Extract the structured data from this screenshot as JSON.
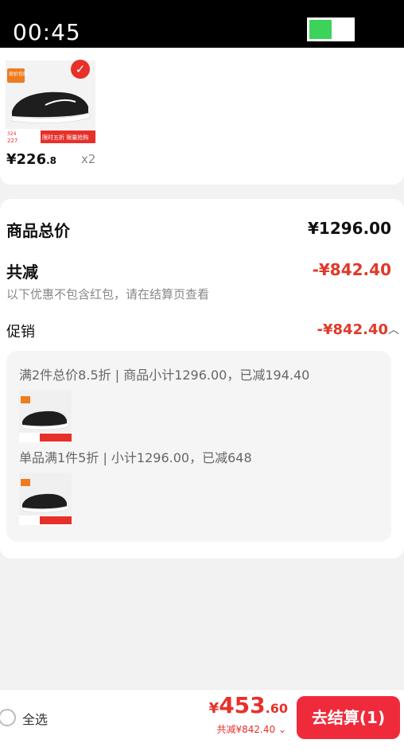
{
  "status": {
    "time": "00:45",
    "battery_fraction": 0.5,
    "battery_color": "#3cd35a"
  },
  "cart_item": {
    "price_int": "¥226",
    "price_dec": ".8",
    "quantity": "x2",
    "badge_top": "现价包邮",
    "thumb_price1": "324",
    "thumb_price2": "227",
    "thumb_banner": "限时五折 限量抢购"
  },
  "summary": {
    "total_label": "商品总价",
    "total_value": "¥1296.00",
    "discount_label": "共减",
    "discount_value": "-¥842.40",
    "note": "以下优惠不包含红包，请在结算页查看",
    "promo_label": "促销",
    "promo_value": "-¥842.40",
    "promo_lines": [
      "满2件总价8.5折 | 商品小计1296.00，已减194.40",
      "单品满1件5折 | 小计1296.00，已减648"
    ]
  },
  "bottom": {
    "select_all": "全选",
    "price_yen": "¥",
    "price_int": "453",
    "price_dec": ".60",
    "discount_text": "共减¥842.40 ⌄",
    "checkout": "去结算(1)"
  },
  "colors": {
    "accent": "#e8302b",
    "checkout": "#ef2a3b"
  }
}
